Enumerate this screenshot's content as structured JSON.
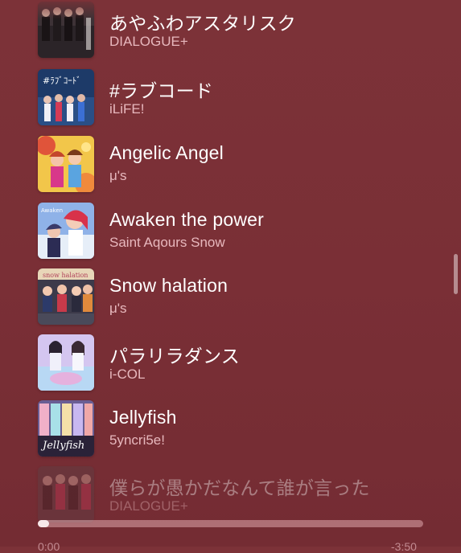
{
  "queue": [
    {
      "title": "あやふわアスタリスク",
      "artist": "DIALOGUE+",
      "art_color": "#2a2226"
    },
    {
      "title": "#ラブコード",
      "artist": "iLiFE!",
      "art_color": "#1f3d6b"
    },
    {
      "title": "Angelic Angel",
      "artist": "μ's",
      "art_color": "#e8b43c"
    },
    {
      "title": "Awaken the power",
      "artist": "Saint Aqours Snow",
      "art_color": "#6e8fd0"
    },
    {
      "title": "Snow halation",
      "artist": "μ's",
      "art_color": "#3a3a48"
    },
    {
      "title": "パラリラダンス",
      "artist": "i-COL",
      "art_color": "#c9b8ea"
    },
    {
      "title": "Jellyfish",
      "artist": "5yncri5e!",
      "art_color": "#7c6fa0"
    },
    {
      "title": "僕らが愚かだなんて誰が言った",
      "artist": "DIALOGUE+",
      "art_color": "#7a5a60"
    }
  ],
  "playback": {
    "progress": 0.03,
    "elapsed": "0:00",
    "remaining": "-3:50"
  },
  "colors": {
    "background": "#7a2f36",
    "title_text": "#ffffff",
    "artist_text": "#ffd6da"
  }
}
